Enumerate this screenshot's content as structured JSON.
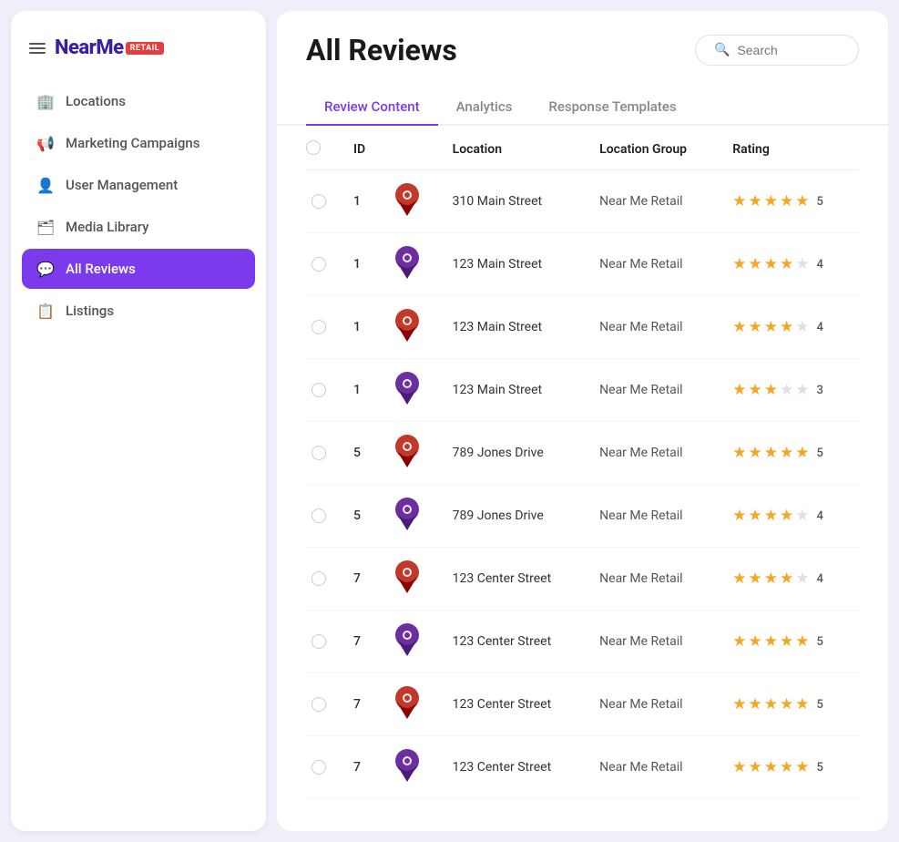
{
  "sidebar": {
    "logo": "NearMe",
    "logo_badge": "RETAIL",
    "nav_items": [
      {
        "id": "locations",
        "label": "Locations",
        "icon": "🏢",
        "active": false
      },
      {
        "id": "marketing",
        "label": "Marketing Campaigns",
        "icon": "📢",
        "active": false
      },
      {
        "id": "users",
        "label": "User Management",
        "icon": "👤",
        "active": false
      },
      {
        "id": "media",
        "label": "Media Library",
        "icon": "🗂",
        "active": false
      },
      {
        "id": "reviews",
        "label": "All Reviews",
        "icon": "💬",
        "active": true
      },
      {
        "id": "listings",
        "label": "Listings",
        "icon": "📋",
        "active": false
      }
    ]
  },
  "header": {
    "title": "All Reviews",
    "search_placeholder": "Search"
  },
  "tabs": [
    {
      "id": "review-content",
      "label": "Review Content",
      "active": true
    },
    {
      "id": "analytics",
      "label": "Analytics",
      "active": false
    },
    {
      "id": "response-templates",
      "label": "Response Templates",
      "active": false
    }
  ],
  "table": {
    "columns": [
      "",
      "ID",
      "",
      "Location",
      "Location Group",
      "Rating"
    ],
    "rows": [
      {
        "id": "1",
        "location": "310 Main Street",
        "group": "Near Me Retail",
        "rating": 5
      },
      {
        "id": "1",
        "location": "123 Main Street",
        "group": "Near Me Retail",
        "rating": 4
      },
      {
        "id": "1",
        "location": "123 Main Street",
        "group": "Near Me Retail",
        "rating": 4
      },
      {
        "id": "1",
        "location": "123 Main Street",
        "group": "Near Me Retail",
        "rating": 3
      },
      {
        "id": "5",
        "location": "789 Jones Drive",
        "group": "Near Me Retail",
        "rating": 5
      },
      {
        "id": "5",
        "location": "789 Jones Drive",
        "group": "Near Me Retail",
        "rating": 4
      },
      {
        "id": "7",
        "location": "123 Center Street",
        "group": "Near Me Retail",
        "rating": 4
      },
      {
        "id": "7",
        "location": "123 Center Street",
        "group": "Near Me Retail",
        "rating": 5
      },
      {
        "id": "7",
        "location": "123 Center Street",
        "group": "Near Me Retail",
        "rating": 5
      },
      {
        "id": "7",
        "location": "123 Center Street",
        "group": "Near Me Retail",
        "rating": 5
      }
    ]
  },
  "colors": {
    "accent": "#7c3aed",
    "star_filled": "#f5a623",
    "star_empty": "#e0e0e0"
  }
}
